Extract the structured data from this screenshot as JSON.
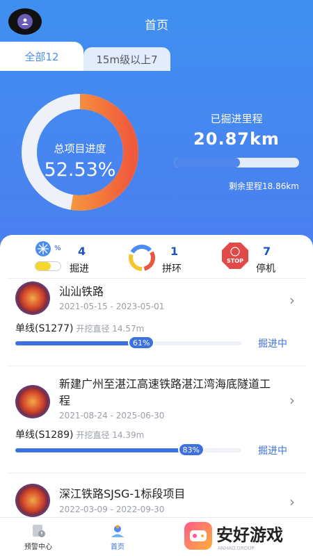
{
  "header": {
    "title": "首页"
  },
  "tabs": [
    {
      "label": "全部12"
    },
    {
      "label": "15m级以上7"
    }
  ],
  "summary": {
    "progress_label": "总项目进度",
    "progress_value": "52.53%",
    "progress_fraction": 0.5253,
    "mileage_label": "已掘进里程",
    "mileage_value": "20.87km",
    "mileage_fraction": 0.53,
    "remaining": "剩余里程18.86km"
  },
  "stats": [
    {
      "count": "4",
      "label": "掘进",
      "icon": "tunneling-icon"
    },
    {
      "count": "1",
      "label": "拼环",
      "icon": "ring-assembly-icon"
    },
    {
      "count": "7",
      "label": "停机",
      "icon": "stop-icon",
      "icon_text": "STOP"
    }
  ],
  "stat_icon_small": "%",
  "projects": [
    {
      "name": "汕汕铁路",
      "date": "2021-05-15 - 2023-05-01",
      "line": "单线(S1277)",
      "diameter": "开挖直径 14.57m",
      "progress": "61%",
      "progress_fraction": 0.61,
      "status": "掘进中"
    },
    {
      "name": "新建广州至湛江高速铁路湛江湾海底隧道工程",
      "date": "2021-08-24 - 2025-06-30",
      "line": "单线(S1289)",
      "diameter": "开挖直径 14.39m",
      "progress": "83%",
      "progress_fraction": 0.83,
      "status": "掘进中"
    },
    {
      "name": "深江铁路SJSG-1标段项目",
      "date": "2022-03-09 - 2022-09-30"
    }
  ],
  "nav": [
    {
      "label": "预警中心",
      "icon": "alert-center-icon"
    },
    {
      "label": "首页",
      "icon": "home-icon",
      "active": true
    }
  ],
  "watermark": {
    "text": "安好游戏",
    "sub": "ANHAO.GROUP"
  },
  "colors": {
    "primary": "#3d71e0",
    "hero": "#4a8cef",
    "ring_fill": "#f4a13a",
    "ring_track": "#eef1f8"
  }
}
